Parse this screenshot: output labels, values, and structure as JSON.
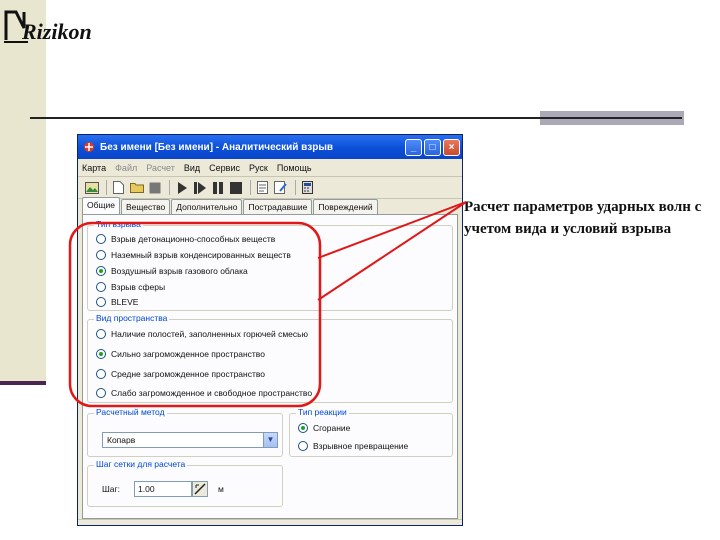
{
  "logo": {
    "text": "Rizikon"
  },
  "caption": "Расчет параметров ударных волн с учетом вида и условий взрыва",
  "window": {
    "title": "Без имени [Без имени] - Аналитический взрыв",
    "controls": {
      "minimize": "_",
      "maximize": "□",
      "close": "×"
    }
  },
  "menu": [
    {
      "label": "Карта",
      "disabled": false
    },
    {
      "label": "Файл",
      "disabled": true
    },
    {
      "label": "Расчет",
      "disabled": true
    },
    {
      "label": "Вид",
      "disabled": false
    },
    {
      "label": "Сервис",
      "disabled": false
    },
    {
      "label": "Руск",
      "disabled": false
    },
    {
      "label": "Помощь",
      "disabled": false
    }
  ],
  "tabs": [
    {
      "label": "Общие",
      "active": true
    },
    {
      "label": "Вещество",
      "active": false
    },
    {
      "label": "Дополнительно",
      "active": false
    },
    {
      "label": "Пострадавшие",
      "active": false
    },
    {
      "label": "Повреждений",
      "active": false
    }
  ],
  "group_explosion": {
    "title": "Тип взрыва",
    "options": [
      {
        "label": "Взрыв детонационно-способных веществ",
        "checked": false
      },
      {
        "label": "Наземный взрыв конденсированных веществ",
        "checked": false
      },
      {
        "label": "Воздушный взрыв газового облака",
        "checked": true
      },
      {
        "label": "Взрыв сферы",
        "checked": false
      },
      {
        "label": "BLEVE",
        "checked": false
      }
    ]
  },
  "group_space": {
    "title": "Вид пространства",
    "options": [
      {
        "label": "Наличие полостей, заполненных горючей смесью",
        "checked": false
      },
      {
        "label": "Сильно загроможденное пространство",
        "checked": true
      },
      {
        "label": "Средне загроможденное пространство",
        "checked": false
      },
      {
        "label": "Слабо загроможденное и свободное пространство",
        "checked": false
      }
    ]
  },
  "group_method": {
    "title": "Расчетный метод",
    "value": "Копарв",
    "arrow": "▼"
  },
  "group_reaction": {
    "title": "Тип реакции",
    "options": [
      {
        "label": "Сгорание",
        "checked": true
      },
      {
        "label": "Взрывное превращение",
        "checked": false
      }
    ]
  },
  "group_grid": {
    "title": "Шаг сетки для расчета",
    "label": "Шаг:",
    "value": "1.00",
    "unit": "м"
  },
  "colors": {
    "title_bar": "#0b4fd8",
    "callout": "#e01818",
    "left_bar": "#e8e6cf",
    "accent_line": "#4a2550"
  }
}
